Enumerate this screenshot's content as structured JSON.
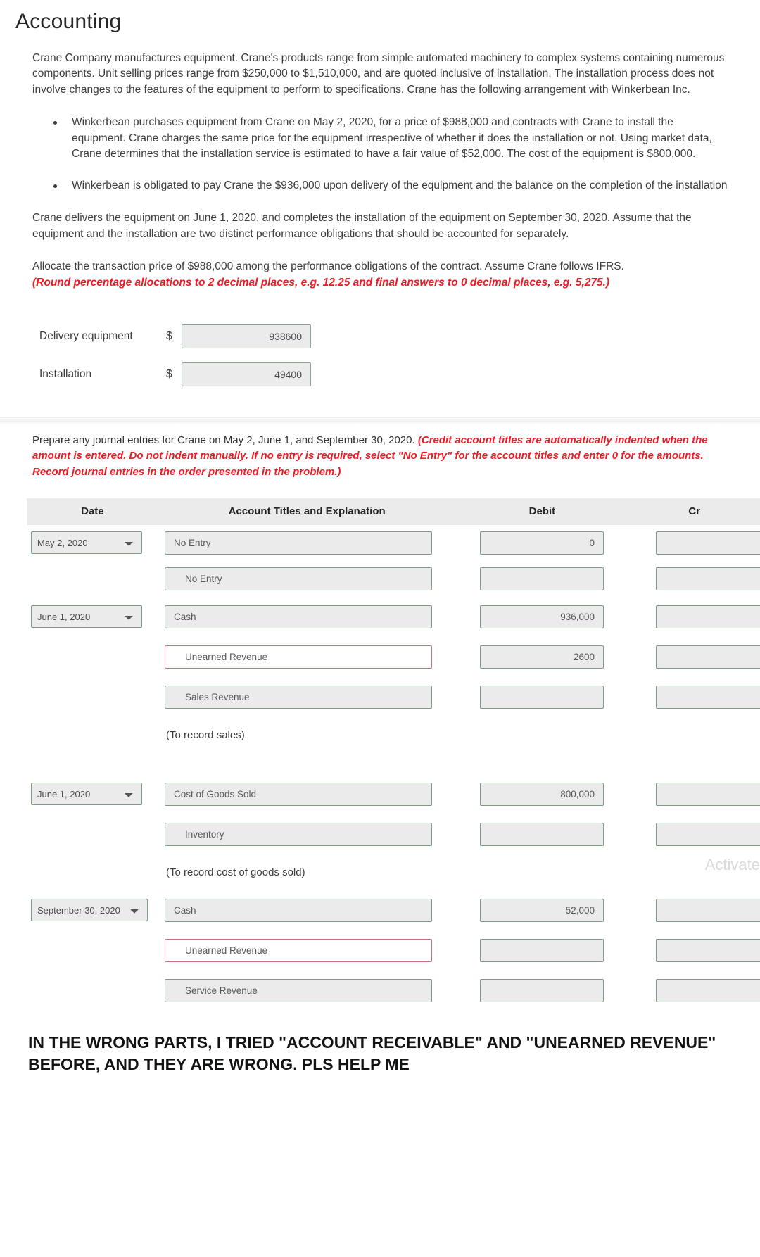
{
  "page_title": "Accounting",
  "intro_paragraph": "Crane Company manufactures equipment. Crane's products range from simple automated machinery to complex systems containing numerous components. Unit selling prices range from $250,000 to $1,510,000, and are quoted inclusive of installation. The installation process does not involve changes to the features of the equipment to perform to specifications. Crane has the following arrangement with Winkerbean Inc.",
  "bullets": [
    "Winkerbean purchases equipment from Crane on May 2, 2020, for a price of $988,000 and contracts with Crane to install the equipment. Crane charges the same price for the equipment irrespective of whether it does the installation or not. Using market data, Crane determines that the installation service is estimated to have a fair value of $52,000. The cost of the equipment is $800,000.",
    "Winkerbean is obligated to pay Crane the $936,000 upon delivery of the equipment and the balance on the completion of the installation"
  ],
  "delivery_paragraph": "Crane delivers the equipment on June 1, 2020, and completes the installation of the equipment on September 30, 2020. Assume that the equipment and the installation are two distinct performance obligations that should be accounted for separately.",
  "allocate_instruction": "Allocate the transaction price of $988,000 among the performance obligations of the contract. Assume Crane follows IFRS.",
  "allocate_instruction_red": "(Round percentage allocations to 2 decimal places, e.g. 12.25 and final answers to 0 decimal places, e.g. 5,275.)",
  "allocation": {
    "currency_symbol": "$",
    "rows": [
      {
        "label": "Delivery equipment",
        "value": "938600"
      },
      {
        "label": "Installation",
        "value": "49400"
      }
    ]
  },
  "journal_instruction_black": "Prepare any journal entries for Crane on May 2, June 1, and September 30, 2020.",
  "journal_instruction_red": "(Credit account titles are automatically indented when the amount is entered. Do not indent manually. If no entry is required, select \"No Entry\" for the account titles and enter 0 for the amounts. Record journal entries in the order presented in the problem.)",
  "journal_table": {
    "headers": {
      "date": "Date",
      "account": "Account Titles and Explanation",
      "debit": "Debit",
      "credit": "Cr"
    },
    "rows": [
      {
        "type": "entry",
        "date": "May 2, 2020",
        "has_date": true,
        "account": "No Entry",
        "indent": false,
        "error": false,
        "debit": "0",
        "credit": ""
      },
      {
        "type": "entry",
        "date": "",
        "has_date": false,
        "account": "No Entry",
        "indent": true,
        "error": false,
        "debit": "",
        "credit": ""
      },
      {
        "type": "entry",
        "date": "June 1, 2020",
        "has_date": true,
        "account": "Cash",
        "indent": false,
        "error": false,
        "debit": "936,000",
        "credit": ""
      },
      {
        "type": "entry",
        "date": "",
        "has_date": false,
        "account": "Unearned Revenue",
        "indent": true,
        "error": true,
        "debit": "2600",
        "credit": ""
      },
      {
        "type": "entry",
        "date": "",
        "has_date": false,
        "account": "Sales Revenue",
        "indent": true,
        "error": false,
        "debit": "",
        "credit": ""
      },
      {
        "type": "note",
        "note": "(To record sales)"
      },
      {
        "type": "entry",
        "date": "June 1, 2020",
        "has_date": true,
        "account": "Cost of Goods Sold",
        "indent": false,
        "error": false,
        "debit": "800,000",
        "credit": ""
      },
      {
        "type": "entry",
        "date": "",
        "has_date": false,
        "account": "Inventory",
        "indent": true,
        "error": false,
        "debit": "",
        "credit": ""
      },
      {
        "type": "note",
        "note": "(To record cost of goods sold)"
      },
      {
        "type": "entry",
        "date": "September 30, 2020",
        "has_date": true,
        "account": "Cash",
        "indent": false,
        "error": false,
        "debit": "52,000",
        "credit": ""
      },
      {
        "type": "entry",
        "date": "",
        "has_date": false,
        "account": "Unearned Revenue",
        "indent": true,
        "error": true,
        "debit": "",
        "credit": ""
      },
      {
        "type": "entry",
        "date": "",
        "has_date": false,
        "account": "Service Revenue",
        "indent": true,
        "error": false,
        "debit": "",
        "credit": ""
      }
    ],
    "date_options": [
      "May 2, 2020",
      "June 1, 2020",
      "September 30, 2020"
    ]
  },
  "watermark": "Activate",
  "footer_message": "IN THE WRONG PARTS, I TRIED \"ACCOUNT RECEIVABLE\" AND \"UNEARNED REVENUE\" BEFORE, AND THEY ARE WRONG. PLS HELP ME",
  "colors": {
    "red_instruction": "#ed1c24",
    "input_border_green": "#7e9c84",
    "input_border_error": "#c9707a",
    "input_bg": "#ebebeb",
    "header_bg": "#ebebeb"
  }
}
